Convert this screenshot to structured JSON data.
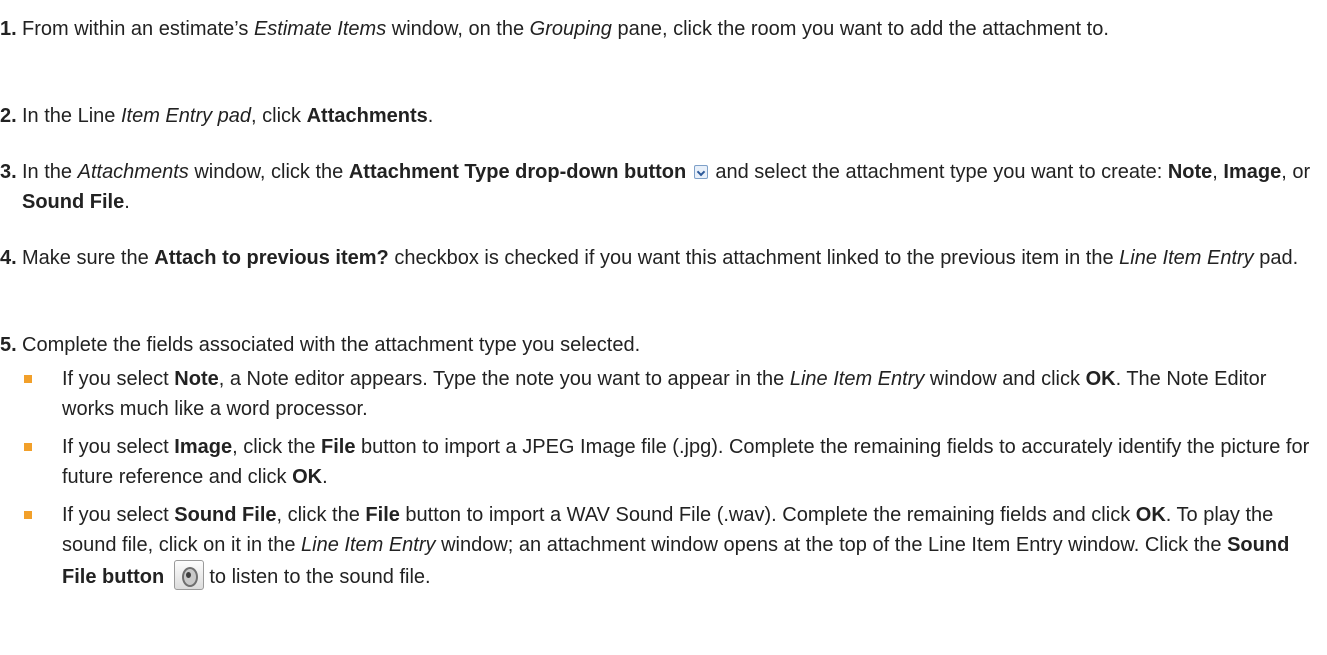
{
  "steps": [
    {
      "num": "1.",
      "a": "From within an estimate’s ",
      "b_i": "Estimate Items",
      "c": " window, on the ",
      "d_i": "Grouping",
      "e": " pane, click the room you want to add the attachment to."
    },
    {
      "num": "2.",
      "a": "In the Line ",
      "b_i": "Item Entry pad",
      "c": ", click ",
      "d_b": "Attachments",
      "e": "."
    },
    {
      "num": "3.",
      "a": "In the ",
      "b_i": "Attachments",
      "c": " window, click the ",
      "d_b": "Attachment Type drop-down button",
      "e": " and select the attachment type you want to create: ",
      "f_b": "Note",
      "g": ", ",
      "h_b": "Image",
      "i": ", or ",
      "j_b": "Sound File",
      "k": "."
    },
    {
      "num": "4.",
      "a": "Make sure the ",
      "b_b": "Attach to previous item?",
      "c": " checkbox is checked if you want this attachment linked to the previous item in the ",
      "d_i": "Line Item Entry",
      "e": " pad."
    },
    {
      "num": "5.",
      "a": "Complete the fields associated with the attachment type you selected."
    }
  ],
  "bullets": [
    {
      "a": "If you select ",
      "b_b": "Note",
      "c": ", a Note editor appears. Type the note you want to appear in the ",
      "d_i": "Line Item Entry",
      "e": " window and click ",
      "f_b": "OK",
      "g": ". The Note Editor works much like a word processor."
    },
    {
      "a": "If you select ",
      "b_b": "Image",
      "c": ", click the ",
      "d_b": "File",
      "e": " button to import a JPEG Image file (.jpg). Complete the remaining fields to accurately identify the picture for future reference and click ",
      "f_b": "OK",
      "g": "."
    },
    {
      "a": "If you select ",
      "b_b": "Sound File",
      "c": ", click the ",
      "d_b": "File",
      "e": " button to import a WAV Sound File (.wav). Complete the remaining fields and click ",
      "f_b": "OK",
      "g": ". To play the sound file, click on it in the ",
      "h_i": "Line Item Entry",
      "i": " window; an attachment window opens at the top of the Line Item Entry window. Click the ",
      "j_b": "Sound File button",
      "k": " to listen to the sound file."
    }
  ],
  "icons": {
    "dropdown": "dropdown-arrow-icon",
    "sound": "speaker-icon",
    "bullet_color": "#f2a02a"
  }
}
